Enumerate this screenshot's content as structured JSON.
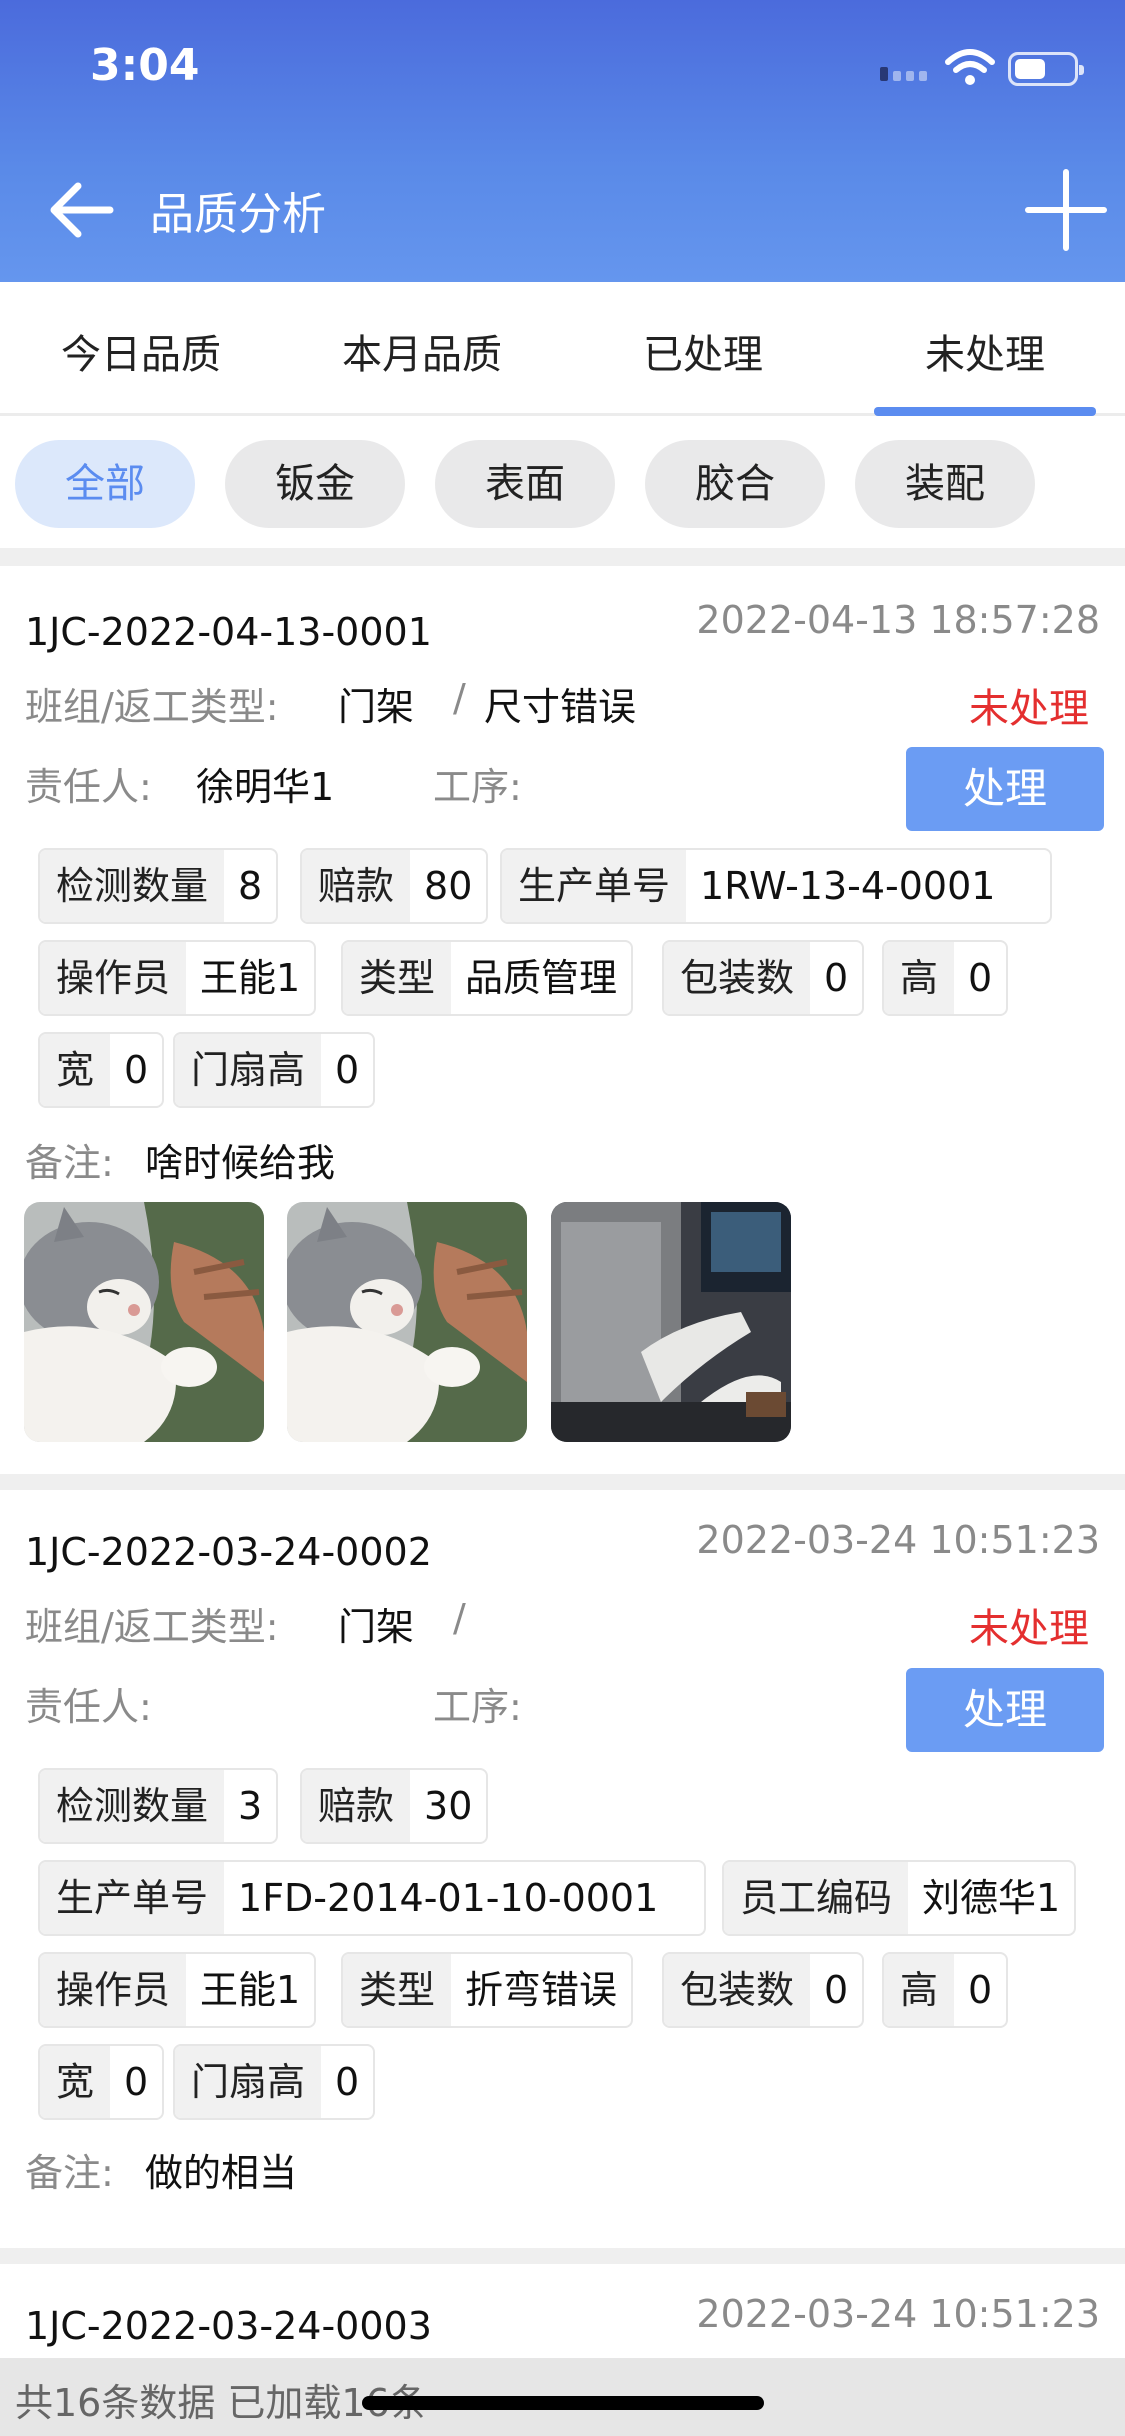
{
  "status_bar": {
    "time": "3:04"
  },
  "header": {
    "title": "品质分析"
  },
  "tabs": [
    {
      "label": "今日品质",
      "active": false
    },
    {
      "label": "本月品质",
      "active": false
    },
    {
      "label": "已处理",
      "active": false
    },
    {
      "label": "未处理",
      "active": true
    }
  ],
  "chips": [
    {
      "label": "全部",
      "active": true
    },
    {
      "label": "钣金",
      "active": false
    },
    {
      "label": "表面",
      "active": false
    },
    {
      "label": "胶合",
      "active": false
    },
    {
      "label": "装配",
      "active": false
    }
  ],
  "colors": {
    "accent": "#5b8cf0",
    "status_red": "#e42f2f",
    "header_top": "#4b6bdc",
    "header_bottom": "#6596ee"
  },
  "records": [
    {
      "code": "1JC-2022-04-13-0001",
      "datetime": "2022-04-13 18:57:28",
      "team_label": "班组/返工类型:",
      "team": "门架",
      "slash": "/",
      "rework": "尺寸错误",
      "status": "未处理",
      "owner_label": "责任人:",
      "owner": "徐明华1",
      "process_label": "工序:",
      "process": "",
      "action": "处理",
      "tags": [
        {
          "key": "检测数量",
          "value": "8"
        },
        {
          "key": "赔款",
          "value": "80"
        },
        {
          "key": "生产单号",
          "value": "1RW-13-4-0001"
        },
        {
          "key": "操作员",
          "value": "王能1"
        },
        {
          "key": "类型",
          "value": "品质管理"
        },
        {
          "key": "包装数",
          "value": "0"
        },
        {
          "key": "高",
          "value": "0"
        },
        {
          "key": "宽",
          "value": "0"
        },
        {
          "key": "门扇高",
          "value": "0"
        }
      ],
      "remark_label": "备注:",
      "remark": "啥时候给我",
      "photos": [
        "cat-photo",
        "cat-photo",
        "room-photo"
      ]
    },
    {
      "code": "1JC-2022-03-24-0002",
      "datetime": "2022-03-24 10:51:23",
      "team_label": "班组/返工类型:",
      "team": "门架",
      "slash": "/",
      "rework": "",
      "status": "未处理",
      "owner_label": "责任人:",
      "owner": "",
      "process_label": "工序:",
      "process": "",
      "action": "处理",
      "tags": [
        {
          "key": "检测数量",
          "value": "3"
        },
        {
          "key": "赔款",
          "value": "30"
        },
        {
          "key": "生产单号",
          "value": "1FD-2014-01-10-0001"
        },
        {
          "key": "员工编码",
          "value": "刘德华1"
        },
        {
          "key": "操作员",
          "value": "王能1"
        },
        {
          "key": "类型",
          "value": "折弯错误"
        },
        {
          "key": "包装数",
          "value": "0"
        },
        {
          "key": "高",
          "value": "0"
        },
        {
          "key": "宽",
          "value": "0"
        },
        {
          "key": "门扇高",
          "value": "0"
        }
      ],
      "remark_label": "备注:",
      "remark": "做的相当"
    },
    {
      "code": "1JC-2022-03-24-0003",
      "datetime": "2022-03-24 10:51:23"
    }
  ],
  "footer": {
    "text": "共16条数据 已加载16条"
  }
}
